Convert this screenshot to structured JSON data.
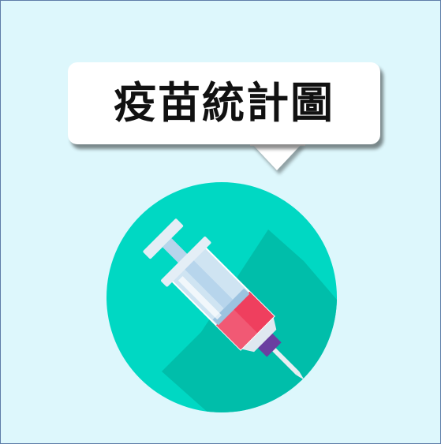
{
  "title": "疫苗統計圖",
  "icon": "syringe-icon",
  "colors": {
    "background": "#ddf7fc",
    "border": "#5e7da8",
    "circle": "#00d8c3",
    "circle_shadow": "#00bba7",
    "liquid": "#ef3f5e",
    "plunger_tip": "#6b3fa0"
  }
}
